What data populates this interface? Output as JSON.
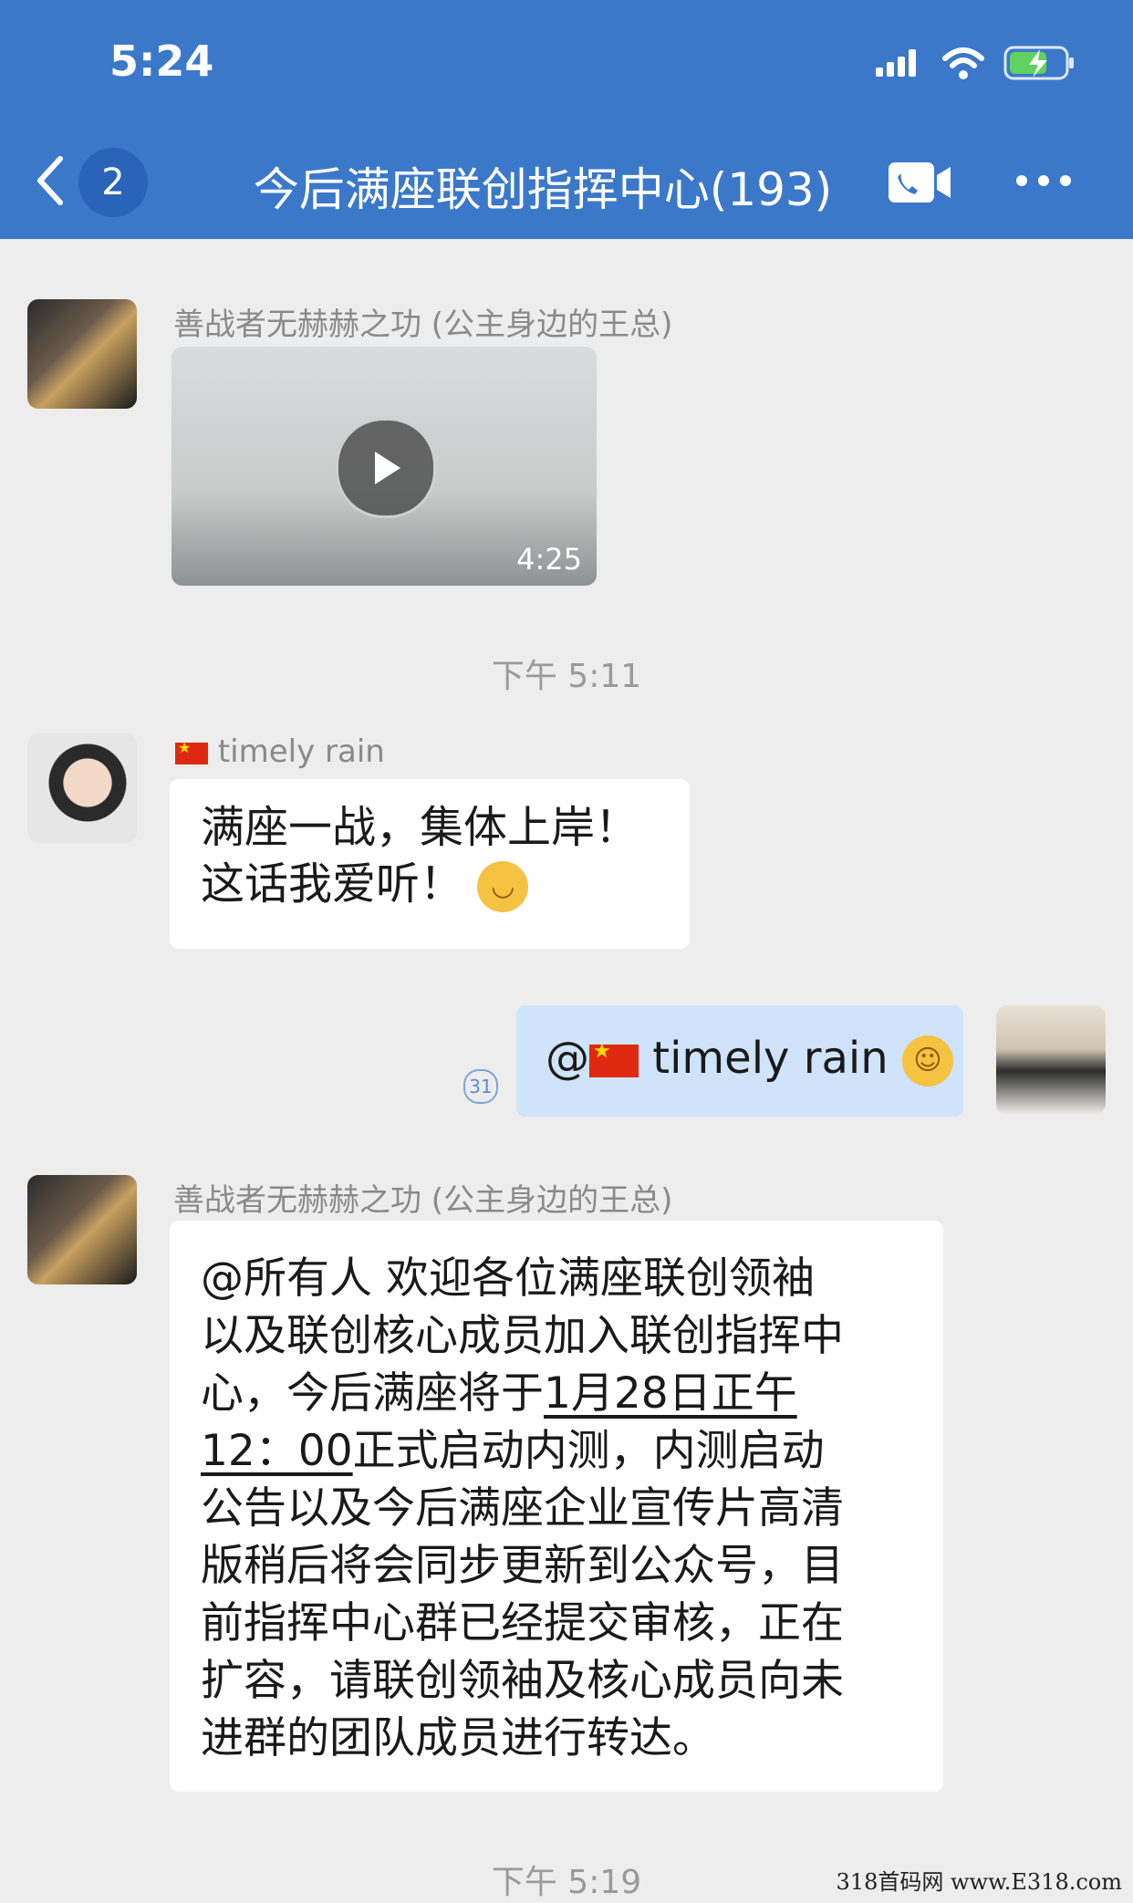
{
  "status_bar": {
    "time": "5:24"
  },
  "header": {
    "unread": "2",
    "title": "今后满座联创指挥中心(193)"
  },
  "messages": [
    {
      "sender": "善战者无赫赫之功 (公主身边的王总)",
      "video_duration": "4:25"
    },
    {
      "timestamp": "下午 5:11"
    },
    {
      "sender": "timely rain",
      "text_line1": "满座一战，集体上岸！",
      "text_line2": "这话我爱听！"
    },
    {
      "mention": "@",
      "name": "timely rain",
      "read_count": "31"
    },
    {
      "sender": "善战者无赫赫之功 (公主身边的王总)",
      "line1": "@所有人 欢迎各位满座联创领袖",
      "line2": "以及联创核心成员加入联创指挥中",
      "line3a": "心，今后满座将于",
      "line3b": "1月28日正午",
      "line4a": "12：00",
      "line4b": "正式启动内测，内测启动",
      "line5": "公告以及今后满座企业宣传片高清",
      "line6": "版稍后将会同步更新到公众号，目",
      "line7": "前指挥中心群已经提交审核，正在",
      "line8": "扩容，请联创领袖及核心成员向未",
      "line9": "进群的团队成员进行转达。"
    },
    {
      "timestamp": "下午 5:19"
    }
  ],
  "watermark": "318首码网 www.E318.com"
}
